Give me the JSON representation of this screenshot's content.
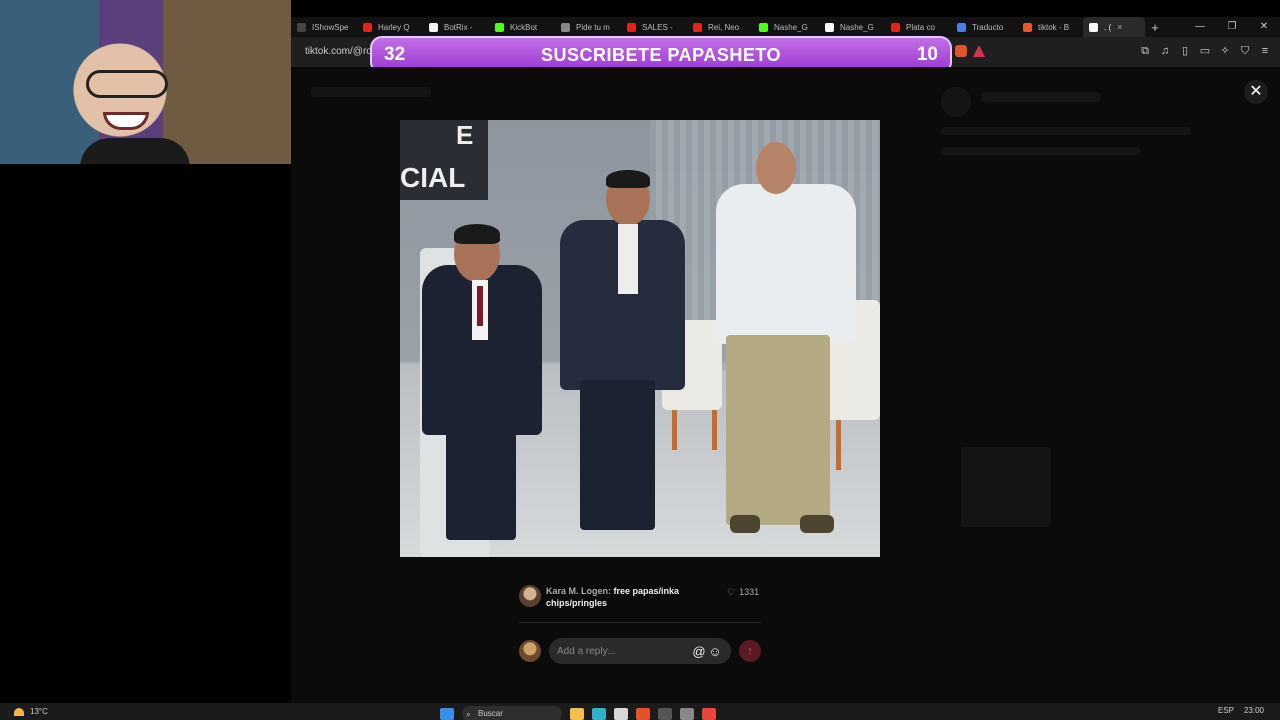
{
  "browser": {
    "tabs": [
      {
        "label": "IShowSpe",
        "favicon_color": "#444444"
      },
      {
        "label": "Harley Q",
        "favicon_color": "#e62117"
      },
      {
        "label": "BotRix -",
        "favicon_color": "#f2f2f2"
      },
      {
        "label": "KickBot",
        "favicon_color": "#53fc18"
      },
      {
        "label": "Pide tu m",
        "favicon_color": "#888888"
      },
      {
        "label": "SALES -",
        "favicon_color": "#e62117"
      },
      {
        "label": "Rei, Neo",
        "favicon_color": "#e62117"
      },
      {
        "label": "Nashe_G",
        "favicon_color": "#53fc18"
      },
      {
        "label": "Nashe_G",
        "favicon_color": "#ffffff"
      },
      {
        "label": "Plata co",
        "favicon_color": "#e62117"
      },
      {
        "label": "Traducto",
        "favicon_color": "#4a7de8"
      },
      {
        "label": "tiktok - B",
        "favicon_color": "#e8562b"
      }
    ],
    "active_tab": {
      "label": ". (",
      "close": "×"
    },
    "new_tab": "+",
    "window_controls": {
      "minimize": "—",
      "maximize": "❐",
      "close": "✕"
    },
    "url": "tiktok.com/@ro",
    "toolbar_icons": [
      "screen-icon",
      "music-icon",
      "sidebar-icon",
      "wallet-icon",
      "leo-icon",
      "shield-icon",
      "menu-icon"
    ],
    "toolbar_glyphs": [
      "⧉",
      "♫",
      "▯",
      "▭",
      "✧",
      "⛉",
      "≡"
    ]
  },
  "banner": {
    "left_number": "32",
    "text": "SUSCRIBETE PAPASHETO",
    "right_number": "10"
  },
  "viewer": {
    "close_label": "✕",
    "photo_sign_text": "CIAL",
    "photo_sign_text_top": "E"
  },
  "comment": {
    "username": "Kara M. Logen:",
    "text": "free papas/inka chips/pringles",
    "likes": "1331",
    "like_icon": "♡"
  },
  "reply": {
    "placeholder": "Add a reply...",
    "mention_icon": "@",
    "emoji_icon": "☺",
    "send_icon": "↑"
  },
  "taskbar": {
    "weather": "13°C",
    "search_label": "Buscar",
    "language": "ESP",
    "time": "23:00",
    "apps": [
      {
        "name": "windows-icon",
        "color": "#3a8ee6"
      },
      {
        "name": "file-explorer-icon",
        "color": "#f2c14e"
      },
      {
        "name": "edge-icon",
        "color": "#2fb0c8"
      },
      {
        "name": "store-icon",
        "color": "#d8d8d8"
      },
      {
        "name": "brave-icon",
        "color": "#e0532b"
      },
      {
        "name": "obs-icon",
        "color": "#555555"
      },
      {
        "name": "settings-icon",
        "color": "#888888"
      },
      {
        "name": "chrome-icon",
        "color": "#e8453c"
      }
    ]
  }
}
